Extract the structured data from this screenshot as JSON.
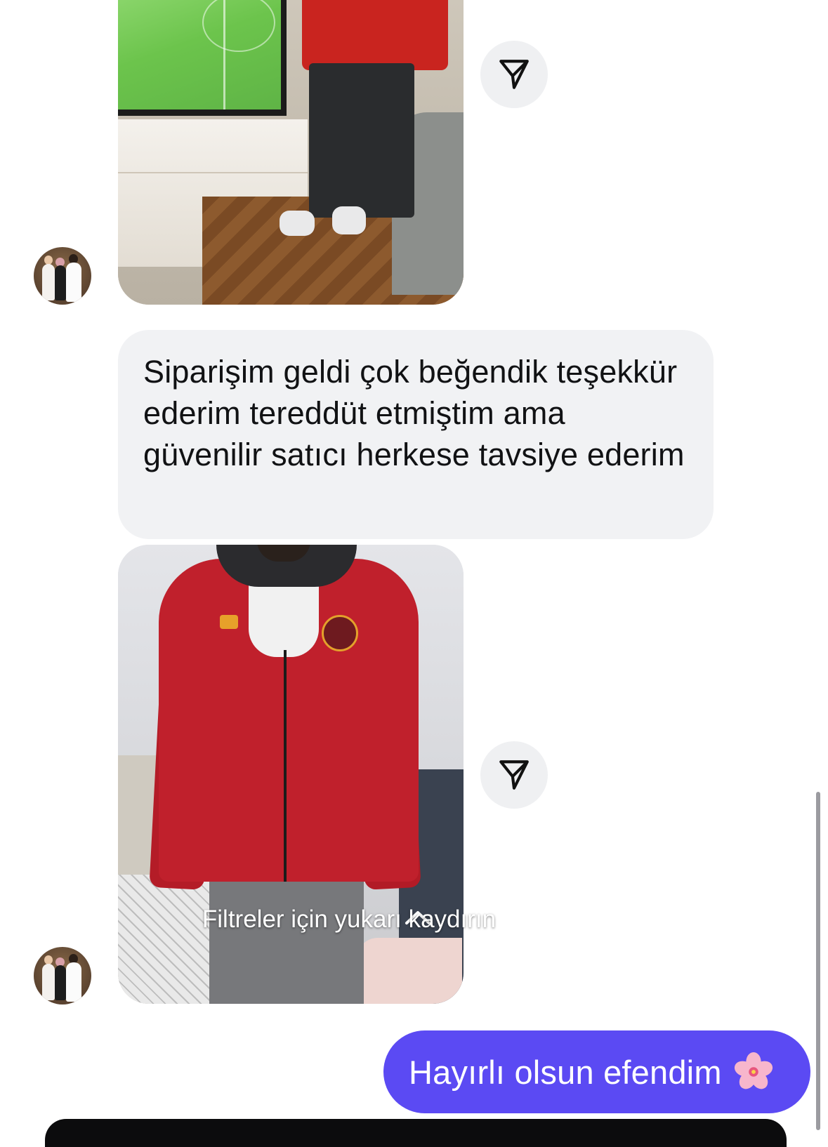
{
  "messages": {
    "incoming_text": "Siparişim geldi çok beğendik teşekkür ederim tereddüt etmiştim ama güvenilir satıcı herkese tavsiye ederim",
    "outgoing_text": "Hayırlı olsun efendim"
  },
  "overlay": {
    "swipe_hint": "Filtreler için yukarı kaydırın"
  },
  "icons": {
    "share": "paper-plane-icon",
    "emoji": "cherry-blossom-icon",
    "chevron": "chevron-up-icon"
  },
  "colors": {
    "outgoing_bubble": "#5b4af3",
    "incoming_bubble": "#f1f2f4",
    "share_button": "#eff0f2"
  }
}
